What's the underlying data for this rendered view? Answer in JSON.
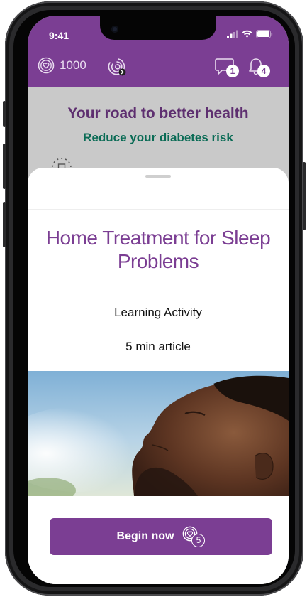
{
  "status_bar": {
    "time": "9:41"
  },
  "header": {
    "points": "1000",
    "messages_badge": "1",
    "notifications_badge": "4",
    "icons": [
      "heart-coin-icon",
      "progress-ring-icon",
      "chat-icon",
      "bell-icon"
    ]
  },
  "background_page": {
    "title": "Your road to better health",
    "subtitle": "Reduce your diabetes risk"
  },
  "sheet": {
    "title": "Home Treatment for Sleep Problems",
    "activity_type": "Learning Activity",
    "duration": "5 min article",
    "begin_label": "Begin now",
    "reward_points": "5"
  },
  "colors": {
    "brand_purple": "#7b3e93",
    "subtitle_green": "#0a6b55"
  }
}
